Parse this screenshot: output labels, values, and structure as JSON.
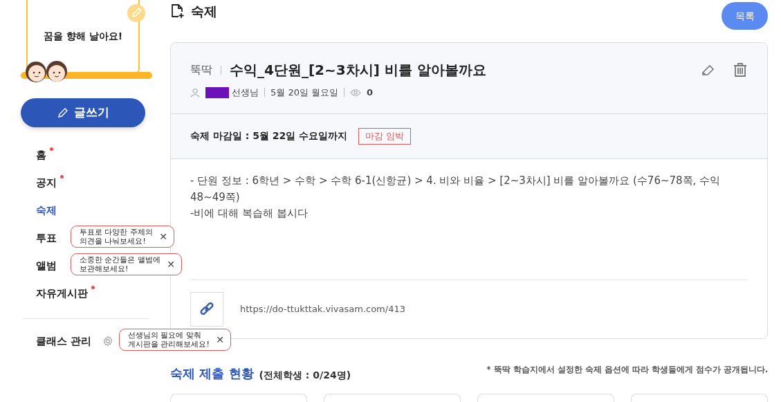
{
  "board": {
    "text": "꿈을 향해 날아요!"
  },
  "write_button": "글쓰기",
  "nav": [
    {
      "label": "홈",
      "selected": false,
      "new": true
    },
    {
      "label": "공지",
      "selected": false,
      "new": true
    },
    {
      "label": "숙제",
      "selected": true,
      "new": false
    },
    {
      "label": "투표",
      "selected": false,
      "new": false,
      "tooltip": {
        "text": "투표로 다양한 주제의\n의견을 나눠보세요!",
        "close": "✕"
      }
    },
    {
      "label": "앨범",
      "selected": false,
      "new": false,
      "tooltip": {
        "text": "소중한 순간들은 앨범에\n보관해보세요!",
        "close": "✕"
      }
    },
    {
      "label": "자유게시판",
      "selected": false,
      "new": true
    }
  ],
  "class_manage": {
    "label": "클래스 관리",
    "tooltip": {
      "text": "선생님의 필요에 맞춰\n게시판을 관리해보세요!",
      "close": "✕"
    }
  },
  "page_title": "숙제",
  "list_button": "목록",
  "post": {
    "category": "뚝딱",
    "title": "수익_4단원_[2~3차시] 비를 알아볼까요",
    "author": "선생님",
    "date": "5월 20일 월요일",
    "views": "0",
    "deadline": "숙제 마감일 : 5월 22일 수요일까지",
    "deadline_tag": "마감 임박",
    "body": [
      "- 단원 정보 : 6학년 > 수학 > 수학 6-1(신항균) > 4. 비와 비율 > [2~3차시] 비를 알아볼까요 (수76~78쪽, 수익48~49쪽)",
      "-비에 대해 복습해 봅시다"
    ],
    "link": "https://do-ttukttak.vivasam.com/413"
  },
  "submission": {
    "title": "숙제 제출 현황",
    "count": "(전체학생 : 0/24명)",
    "note": "* 뚝딱 학습지에서 설정한 숙제 옵션에 따라 학생들에게 점수가 공개됩니다."
  }
}
